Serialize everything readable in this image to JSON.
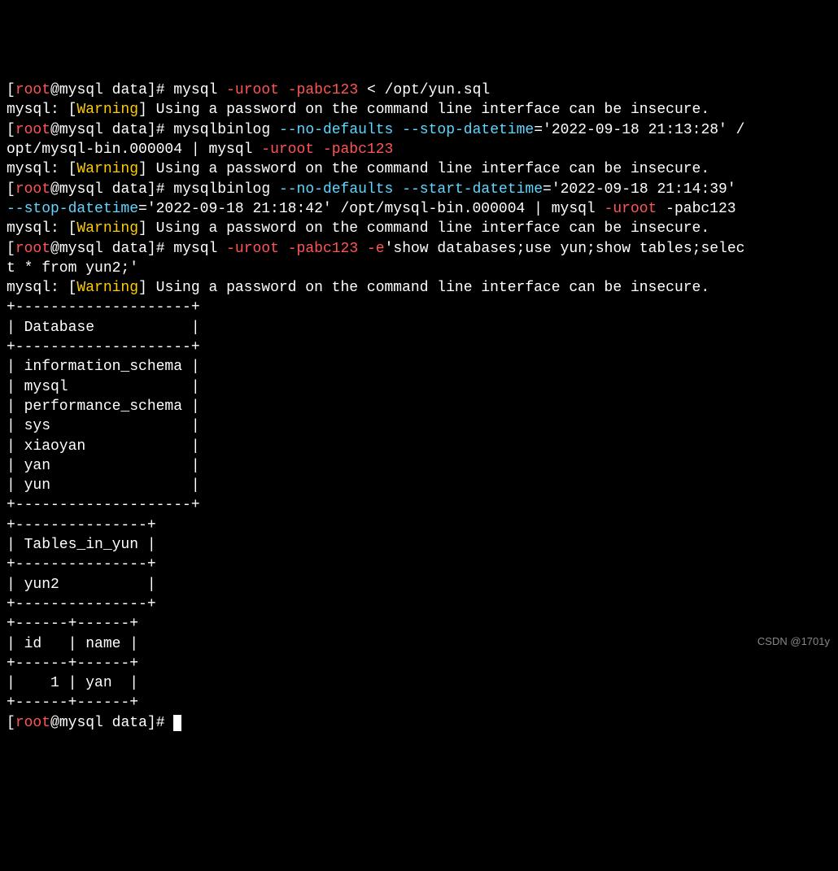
{
  "prompt": {
    "open": "[",
    "user": "root",
    "at": "@",
    "host": "mysql",
    "dir": "data",
    "close": "]# "
  },
  "cmd": {
    "mysql": "mysql",
    "mysqlbinlog": "mysqlbinlog"
  },
  "flag": {
    "uroot": "-uroot",
    "pabc123": "-pabc123",
    "no_defaults": "--no-defaults",
    "stop_datetime": "--stop-datetime",
    "start_datetime": "--start-datetime",
    "e": "-e"
  },
  "val": {
    "sqlfile": "< /opt/yun.sql",
    "dt1": "='2022-09-18 21:13:28' /",
    "binfile1": "opt/mysql-bin.000004 | mysql",
    "dt2": "='2022-09-18 21:14:39'",
    "dt3": "='2022-09-18 21:18:42' /opt/mysql-bin.000004 | mysql",
    "pabc_end": "-pabc123",
    "equery1": "'show databases;use yun;show tables;selec",
    "equery2": "t * from yun2;'"
  },
  "warn": {
    "prefix": "mysql: [",
    "warning": "Warning",
    "suffix": "] Using a password on the command line interface can be insecure."
  },
  "table": {
    "db_border": "+--------------------+",
    "db_header": "| Database           |",
    "db_rows": [
      "| information_schema |",
      "| mysql              |",
      "| performance_schema |",
      "| sys                |",
      "| xiaoyan            |",
      "| yan                |",
      "| yun                |"
    ],
    "t_border": "+---------------+",
    "t_header": "| Tables_in_yun |",
    "t_rows": [
      "| yun2          |"
    ],
    "r_border": "+------+------+",
    "r_header": "| id   | name |",
    "r_rows": [
      "|    1 | yan  |"
    ]
  },
  "watermark": "CSDN @1701y"
}
